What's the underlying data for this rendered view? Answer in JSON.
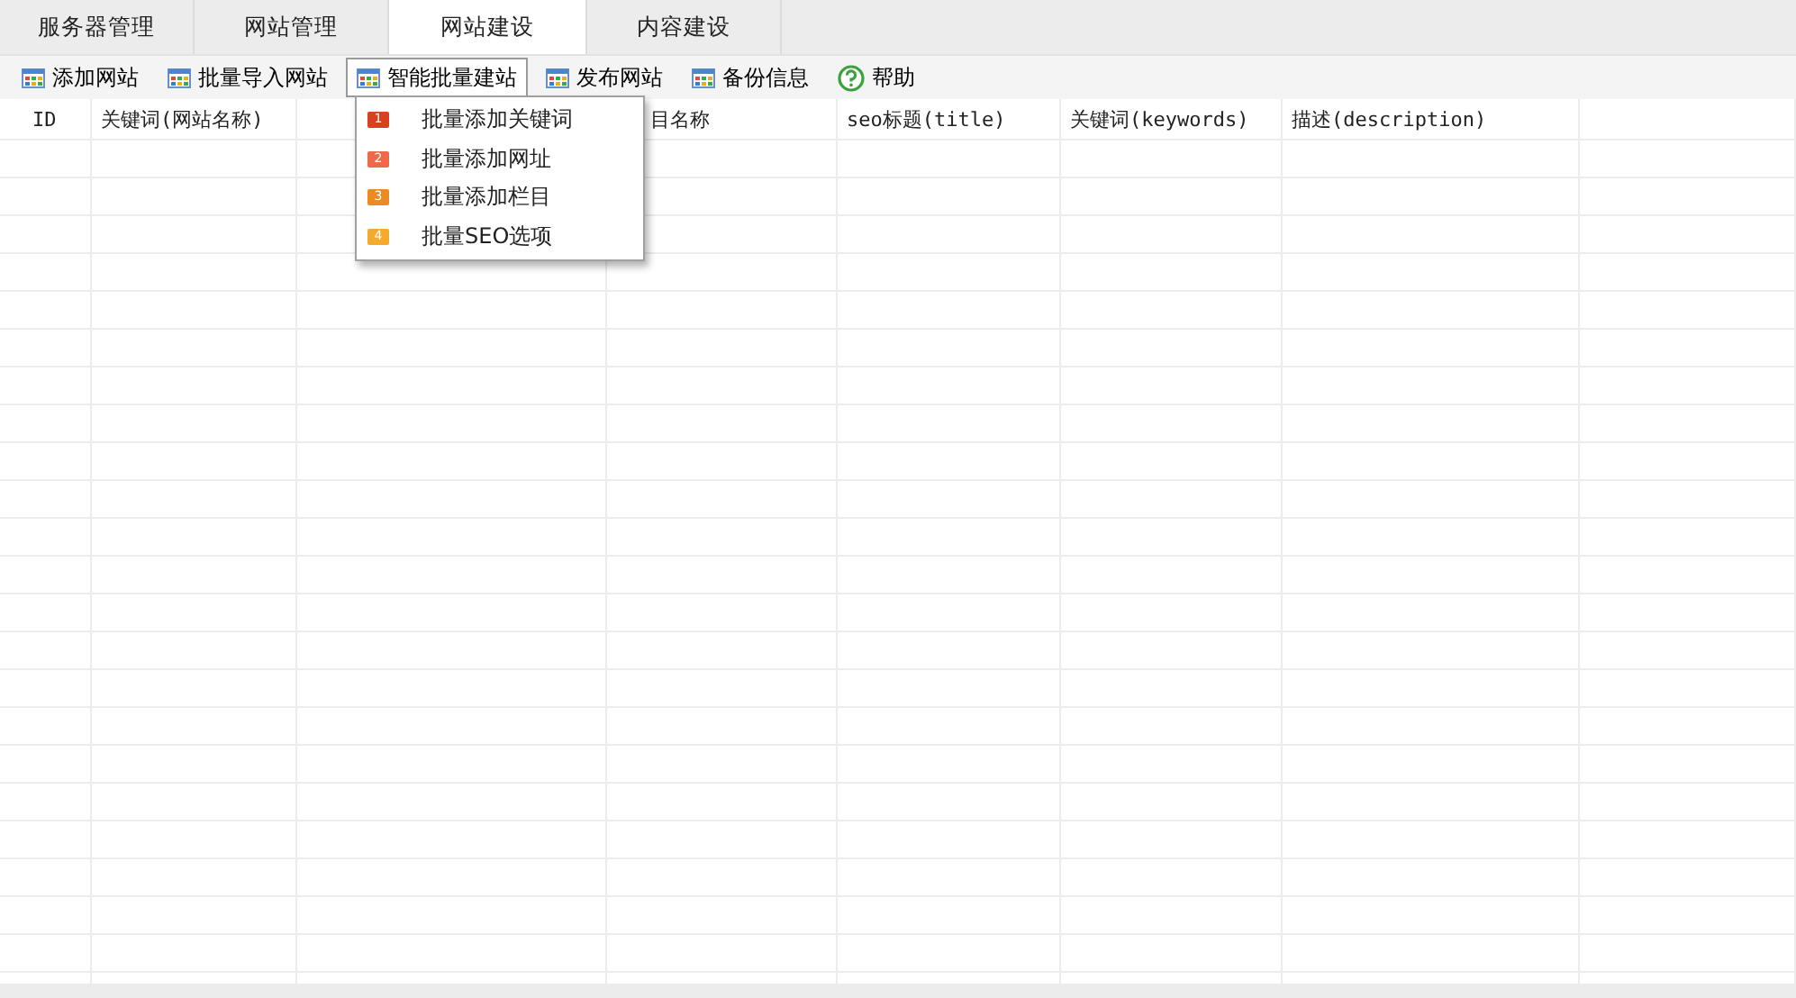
{
  "tabs": [
    {
      "label": "服务器管理",
      "selected": false
    },
    {
      "label": "网站管理",
      "selected": false
    },
    {
      "label": "网站建设",
      "selected": true
    },
    {
      "label": "内容建设",
      "selected": false
    }
  ],
  "toolbar": [
    {
      "label": "添加网站",
      "kind": "table",
      "open": false
    },
    {
      "label": "批量导入网站",
      "kind": "table",
      "open": false
    },
    {
      "label": "智能批量建站",
      "kind": "table",
      "open": true
    },
    {
      "label": "发布网站",
      "kind": "table",
      "open": false
    },
    {
      "label": "备份信息",
      "kind": "table",
      "open": false
    },
    {
      "label": "帮助",
      "kind": "help",
      "open": false
    }
  ],
  "menu": {
    "items": [
      {
        "badge": "1",
        "label": "批量添加关键词",
        "color": "#d8401f"
      },
      {
        "badge": "2",
        "label": "批量添加网址",
        "color": "#ec6a48"
      },
      {
        "badge": "3",
        "label": "批量添加栏目",
        "color": "#ef8a22"
      },
      {
        "badge": "4",
        "label": "批量SEO选项",
        "color": "#f4aa2c"
      }
    ]
  },
  "table": {
    "columns": [
      {
        "label": "ID"
      },
      {
        "label": "关键词(网站名称)"
      },
      {},
      {
        "label": "目名称"
      },
      {
        "label": "seo标题(title)"
      },
      {
        "label": "关键词(keywords)"
      },
      {
        "label": "描述(description)"
      },
      {}
    ]
  }
}
